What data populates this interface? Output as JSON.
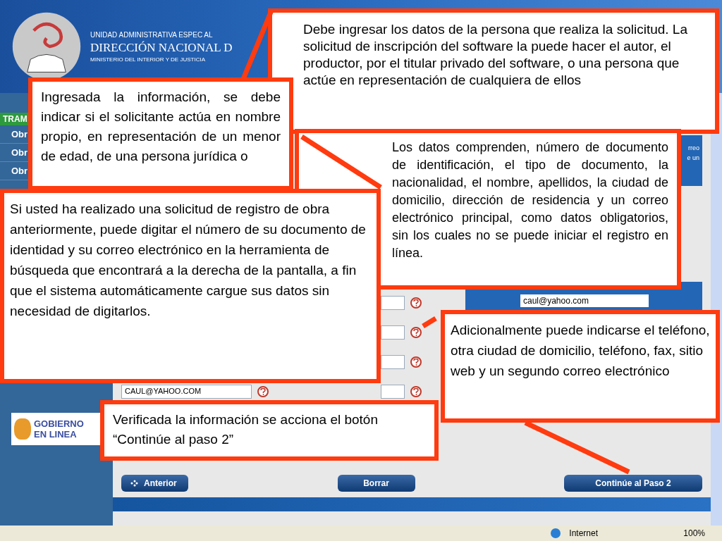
{
  "header": {
    "agency_line": "UNIDAD ADMINISTRATIVA ESPEC AL",
    "title": "DIRECCIÓN NACIONAL D",
    "ministry": "MINISTERIO DEL INTERIOR Y DE JUSTICIA"
  },
  "sidebar": {
    "section": "TRAM",
    "items": [
      "Obr",
      "Obr",
      "Obr"
    ],
    "logo_lines": [
      "GOBIERNO",
      "EN LINEA"
    ]
  },
  "form": {
    "rows": [
      {
        "kind": "blank"
      },
      {
        "kind": "blank"
      },
      {
        "kind": "blank"
      },
      {
        "kind": "email",
        "value": "CAUL@YAHOO.COM"
      }
    ]
  },
  "side_panel": {
    "text_lines": [
      "rreo",
      "e un"
    ],
    "email": "caul@yahoo.com"
  },
  "buttons": [
    {
      "label": "Anterior",
      "kind": "back"
    },
    {
      "label": "Borrar",
      "kind": "plain"
    },
    {
      "label": "Continúe al Paso 2",
      "kind": "plain"
    }
  ],
  "status_bar": {
    "zone": "Internet",
    "zoom": "100%"
  },
  "callouts": [
    {
      "text": "Debe ingresar los datos de la persona que realiza la solicitud. La solicitud de inscripción del software la puede hacer el autor, el productor, por el titular privado del software, o una persona que actúe en representación de cualquiera de ellos"
    },
    {
      "text": "Ingresada la información, se debe indicar si el solicitante actúa en nombre propio, en representación de un menor de edad, de una persona jurídica o"
    },
    {
      "text": "Si usted ha realizado una solicitud de registro de obra anteriormente, puede digitar el número de su documento de identidad y su correo electrónico en la herramienta de búsqueda que encontrará a la derecha de la pantalla, a fin que el sistema automáticamente cargue sus datos sin necesidad de digitarlos."
    },
    {
      "text": "Los datos comprenden, número de documento de identificación, el tipo de documento, la nacionalidad, el nombre, apellidos, la ciudad de domicilio, dirección de residencia y un correo electrónico principal, como datos obligatorios, sin los cuales no se puede iniciar el registro en línea."
    },
    {
      "text": "Adicionalmente puede indicarse el teléfono, otra ciudad de domicilio, teléfono, fax, sitio web y un segundo correo electrónico"
    },
    {
      "text": "Verificada la información se acciona el botón “Continúe al paso 2”"
    }
  ]
}
